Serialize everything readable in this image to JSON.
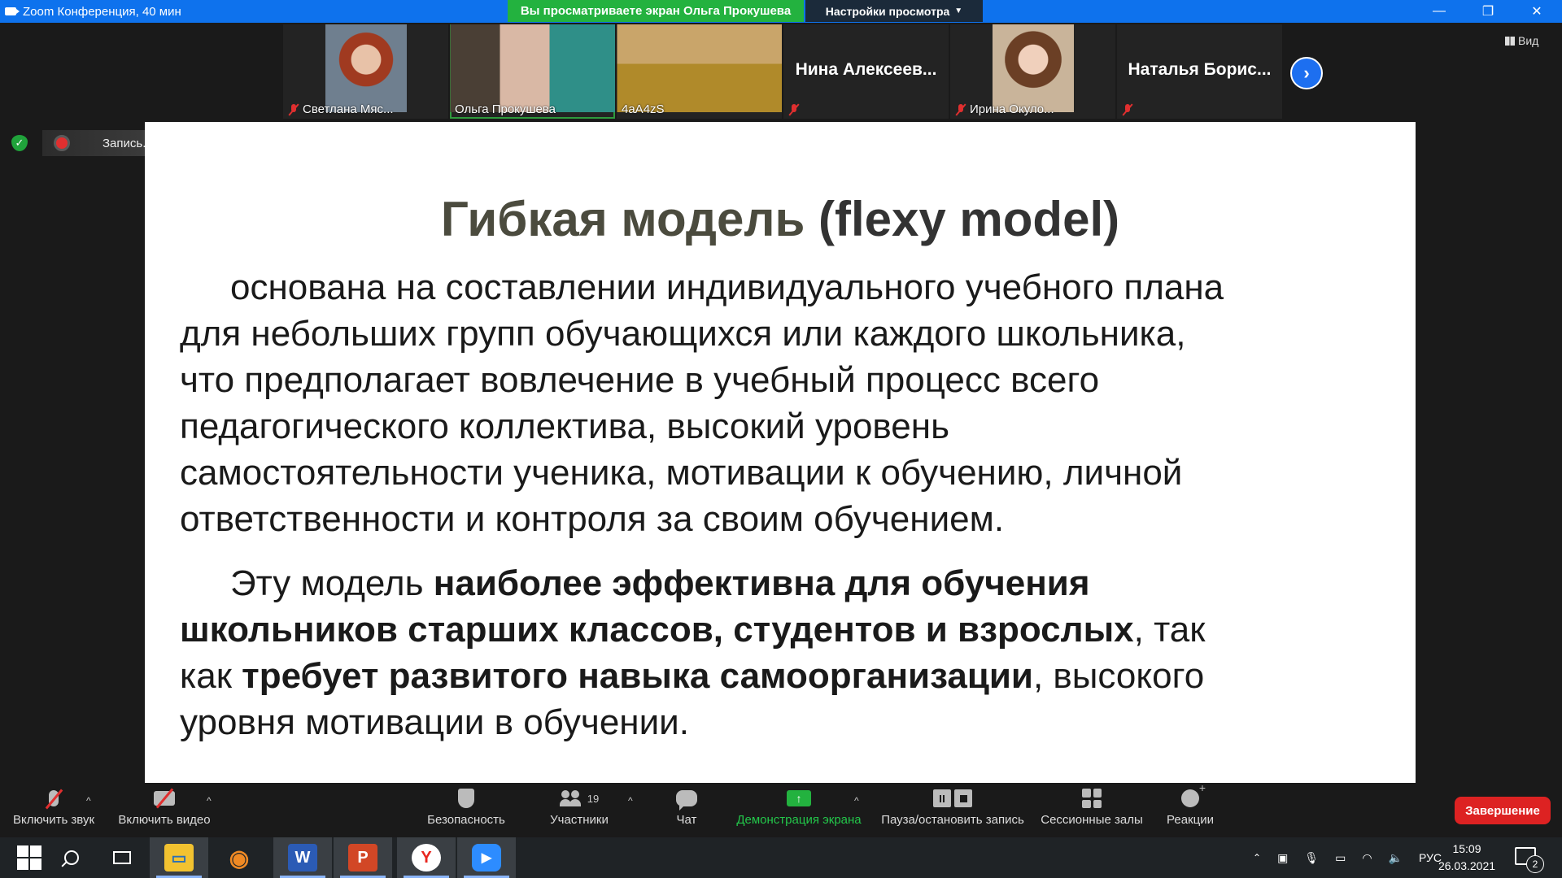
{
  "window": {
    "title": "Zoom Конференция, 40 мин",
    "share_banner": "Вы просматриваете экран Ольга Прокушева",
    "view_options": "Настройки просмотра",
    "view_button": "Вид",
    "minimize": "—",
    "restore": "❐",
    "close": "✕"
  },
  "participants": [
    {
      "name": "Светлана Мяс...",
      "muted": true,
      "type": "photo",
      "color": "#b07a5a"
    },
    {
      "name": "Ольга Прокушева",
      "muted": false,
      "type": "video",
      "active": true,
      "color": "#3a8f86"
    },
    {
      "name": "4aA4zS",
      "muted": false,
      "type": "video",
      "color": "#7d6a3a"
    },
    {
      "name": "Нина  Алексеев...",
      "muted": true,
      "type": "name"
    },
    {
      "name": "Ирина Окуло...",
      "muted": true,
      "type": "photo",
      "color": "#8a6a4a"
    },
    {
      "name": "Наталья  Борис...",
      "muted": true,
      "type": "name"
    }
  ],
  "recording": {
    "label": "Запись..."
  },
  "slide": {
    "title_part1": "Гибкая  модель",
    "title_part2": "(flexy model)",
    "para1_lines": [
      "основана на составлении индивидуального учебного плана",
      "для небольших групп обучающихся или каждого школьника,",
      "что предполагает вовлечение в учебный процесс всего",
      "педагогического коллектива, высокий уровень",
      "самостоятельности ученика, мотивации к обучению, личной",
      "ответственности и контроля за своим обучением."
    ],
    "para2": {
      "l1_normal": "Эту модель ",
      "l1_bold": "наиболее эффективна для обучения",
      "l2_bold": "школьников старших классов, студентов и взрослых",
      "l2_normal": ", так",
      "l3_normal": "как ",
      "l3_bold": "требует развитого навыка самоорганизации",
      "l3_tail": ", высокого",
      "l4_normal": "уровня мотивации в обучении."
    }
  },
  "toolbar": {
    "audio": "Включить звук",
    "video": "Включить видео",
    "security": "Безопасность",
    "participants": "Участники",
    "participants_count": "19",
    "chat": "Чат",
    "share": "Демонстрация экрана",
    "record_control": "Пауза/остановить запись",
    "breakout": "Сессионные залы",
    "reactions": "Реакции",
    "end": "Завершение"
  },
  "taskbar": {
    "language": "РУС",
    "time": "15:09",
    "date": "26.03.2021",
    "notifications": "2",
    "apps": [
      "Проводник",
      "Blender",
      "Word",
      "PowerPoint",
      "Яндекс",
      "Zoom"
    ]
  },
  "colors": {
    "titlebar": "#0e72ed",
    "share_banner": "#23b23f",
    "end_button": "#dd2222",
    "muted_red": "#e02f2f"
  }
}
